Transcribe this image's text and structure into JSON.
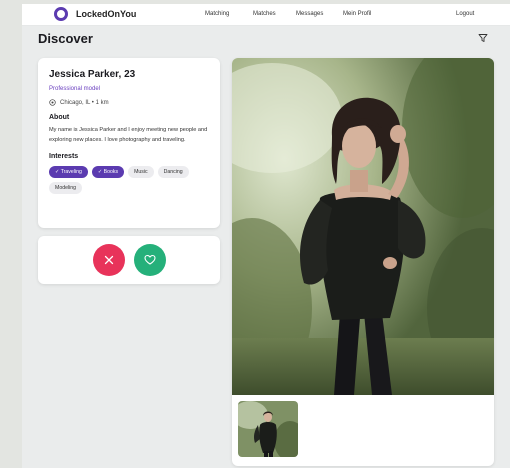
{
  "nav": {
    "brand": "LockedOnYou",
    "links": [
      "Matching",
      "Matches",
      "Messages",
      "Mein Profil"
    ],
    "logout": "Logout"
  },
  "page": {
    "title": "Discover"
  },
  "profile": {
    "name": "Jessica Parker, 23",
    "role": "Professional model",
    "location": "Chicago, IL • 1 km",
    "about_title": "About",
    "about_text": "My name is Jessica Parker and I enjoy meeting new people and exploring new places. I love photography and traveling.",
    "interests_title": "Interests",
    "interests": [
      {
        "label": "✓ Traveling",
        "selected": true
      },
      {
        "label": "✓ Books",
        "selected": true
      },
      {
        "label": "Music",
        "selected": false
      },
      {
        "label": "Dancing",
        "selected": false
      },
      {
        "label": "Modeling",
        "selected": false
      }
    ]
  },
  "actions": {
    "reject_icon": "close-icon",
    "like_icon": "heart-icon"
  },
  "colors": {
    "accent": "#5b3bb0",
    "reject": "#e8335a",
    "like": "#25b07a"
  },
  "photos": {
    "main": "woman-in-black-dress-outdoors",
    "thumbnails": [
      "woman-in-black-dress-outdoors"
    ]
  }
}
